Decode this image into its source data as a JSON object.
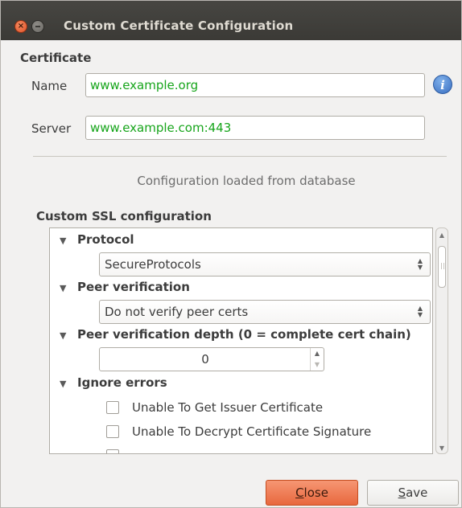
{
  "window": {
    "title": "Custom Certificate Configuration"
  },
  "certificate": {
    "group_title": "Certificate",
    "name_label": "Name",
    "name_value": "www.example.org",
    "server_label": "Server",
    "server_value": "www.example.com:443",
    "info_icon": "info-icon",
    "info_glyph": "i"
  },
  "status": {
    "message": "Configuration loaded from database"
  },
  "ssl": {
    "group_title": "Custom SSL configuration",
    "sections": {
      "protocol": {
        "label": "Protocol",
        "value": "SecureProtocols"
      },
      "peer_verification": {
        "label": "Peer verification",
        "value": "Do not verify peer certs"
      },
      "peer_depth": {
        "label": "Peer verification depth (0 = complete cert chain)",
        "value": "0"
      },
      "ignore_errors": {
        "label": "Ignore errors",
        "items": [
          {
            "label": "Unable To Get Issuer Certificate",
            "checked": false
          },
          {
            "label": "Unable To Decrypt Certificate Signature",
            "checked": false
          }
        ]
      }
    }
  },
  "buttons": {
    "close_mnemonic": "C",
    "close_rest": "lose",
    "save_mnemonic": "S",
    "save_rest": "ave"
  },
  "colors": {
    "titlebar": "#3b3a36",
    "input_text": "#17a51b",
    "close_button": "#e8683e",
    "info_icon": "#3a6fc2"
  }
}
